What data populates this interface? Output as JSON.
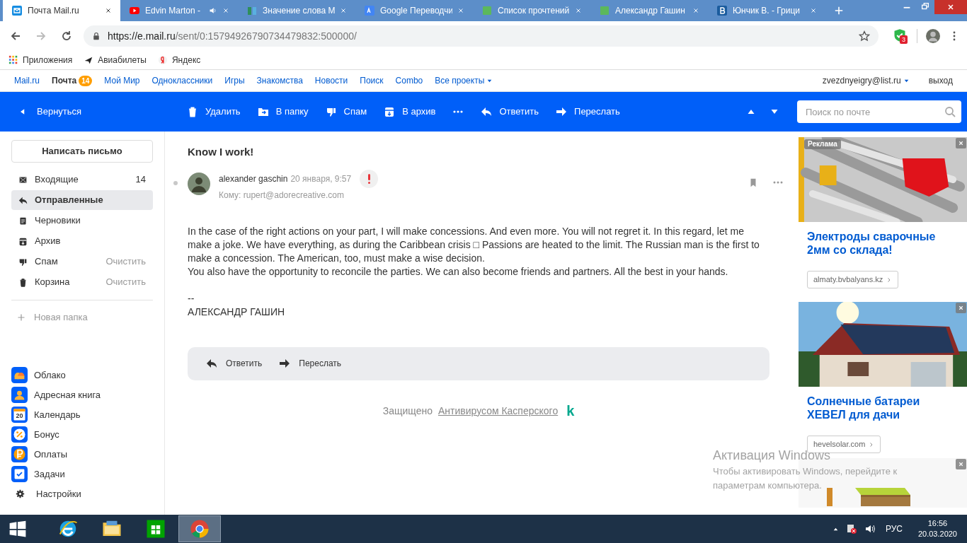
{
  "browser": {
    "tabs": [
      {
        "title": "Почта Mail.ru",
        "kind": "mail",
        "selected": true,
        "audio": false
      },
      {
        "title": "Edvin Marton -",
        "kind": "video",
        "selected": false,
        "audio": true
      },
      {
        "title": "Значение слова М",
        "kind": "book",
        "selected": false,
        "audio": false
      },
      {
        "title": "Google Переводчи",
        "kind": "translate",
        "selected": false,
        "audio": false
      },
      {
        "title": "Список прочтений",
        "kind": "sheet",
        "selected": false,
        "audio": false
      },
      {
        "title": "Александр Гашин",
        "kind": "sheet",
        "selected": false,
        "audio": false
      },
      {
        "title": "Юнчик В. - Грици",
        "kind": "letter",
        "selected": false,
        "audio": false
      }
    ],
    "url_host": "https://e.mail.ru",
    "url_path": "/sent/0:15794926790734479832:500000/",
    "extension_badge": "3",
    "bookmarks": [
      {
        "label": "Приложения",
        "kind": "apps"
      },
      {
        "label": "Авиабилеты",
        "kind": "plane"
      },
      {
        "label": "Яндекс",
        "kind": "yandex"
      }
    ]
  },
  "portal_nav": {
    "items": [
      {
        "label": "Mail.ru",
        "selected": false
      },
      {
        "label": "Почта",
        "selected": true,
        "badge": "14"
      },
      {
        "label": "Мой Мир",
        "selected": false
      },
      {
        "label": "Одноклассники",
        "selected": false
      },
      {
        "label": "Игры",
        "selected": false
      },
      {
        "label": "Знакомства",
        "selected": false
      },
      {
        "label": "Новости",
        "selected": false
      },
      {
        "label": "Поиск",
        "selected": false
      },
      {
        "label": "Combo",
        "selected": false
      },
      {
        "label": "Все проекты",
        "selected": false,
        "dropdown": true
      }
    ],
    "account": "zvezdnyeigry@list.ru",
    "logout": "выход"
  },
  "toolbar": {
    "back": "Вернуться",
    "actions": [
      {
        "label": "Удалить",
        "kind": "trash"
      },
      {
        "label": "В папку",
        "kind": "folder"
      },
      {
        "label": "Спам",
        "kind": "spam"
      },
      {
        "label": "В архив",
        "kind": "archive"
      },
      {
        "kind": "more"
      },
      {
        "label": "Ответить",
        "kind": "reply"
      },
      {
        "label": "Переслать",
        "kind": "forward"
      }
    ],
    "search_placeholder": "Поиск по почте"
  },
  "sidebar": {
    "compose": "Написать письмо",
    "folders": [
      {
        "label": "Входящие",
        "kind": "inbox",
        "count": "14",
        "selected": false
      },
      {
        "label": "Отправленные",
        "kind": "sent",
        "selected": true
      },
      {
        "label": "Черновики",
        "kind": "drafts",
        "selected": false
      },
      {
        "label": "Архив",
        "kind": "archive",
        "selected": false
      },
      {
        "label": "Спам",
        "kind": "spam",
        "action": "Очистить",
        "selected": false
      },
      {
        "label": "Корзина",
        "kind": "trash",
        "action": "Очистить",
        "selected": false
      }
    ],
    "new_folder": "Новая папка",
    "apps": [
      {
        "label": "Облако",
        "kind": "cloud"
      },
      {
        "label": "Адресная книга",
        "kind": "contacts"
      },
      {
        "label": "Календарь",
        "kind": "calendar",
        "day": "20"
      },
      {
        "label": "Бонус",
        "kind": "bonus"
      },
      {
        "label": "Оплаты",
        "kind": "payments"
      },
      {
        "label": "Задачи",
        "kind": "tasks"
      }
    ],
    "settings": "Настройки"
  },
  "message": {
    "subject": "Know I work!",
    "sender": "alexander gaschin",
    "date": "20 января, 9:57",
    "important": true,
    "recipient": "Кому: rupert@adorecreative.com",
    "body": [
      "In the case of the right actions on your part, I will make concessions. And even more. You will not regret it. In this regard, let me make a joke. We have everything, as during the Caribbean crisis □ Passions are heated to the limit. The Russian man is the first to make a concession. The American, too, must make a wise decision.",
      "You also have the opportunity to reconcile the parties. We can also become friends and partners. All the best in your hands."
    ],
    "signature": [
      "--",
      "АЛЕКСАНДР ГАШИН"
    ],
    "actions": [
      {
        "label": "Ответить",
        "kind": "reply"
      },
      {
        "label": "Переслать",
        "kind": "forward"
      }
    ]
  },
  "protection": {
    "text": "Защищено",
    "link": "Антивирусом Касперского",
    "logo": "k"
  },
  "ads": [
    {
      "kind": "metal",
      "label": "Реклама",
      "title": "Электроды сварочные 2мм со склада!",
      "domain": "almaty.bvbalyans.kz"
    },
    {
      "kind": "house",
      "title": "Солнечные батареи ХЕВЕЛ для дачи",
      "domain": "hevelsolar.com"
    },
    {
      "kind": "box"
    }
  ],
  "windows_activation": {
    "title": "Активация Windows",
    "text": "Чтобы активировать Windows, перейдите к параметрам компьютера."
  },
  "taskbar": {
    "apps": [
      {
        "kind": "ie",
        "selected": false
      },
      {
        "kind": "explorer",
        "selected": false
      },
      {
        "kind": "store",
        "selected": false
      },
      {
        "kind": "chrome",
        "selected": true
      }
    ],
    "language": "РУС",
    "time": "16:56",
    "date": "20.03.2020"
  }
}
